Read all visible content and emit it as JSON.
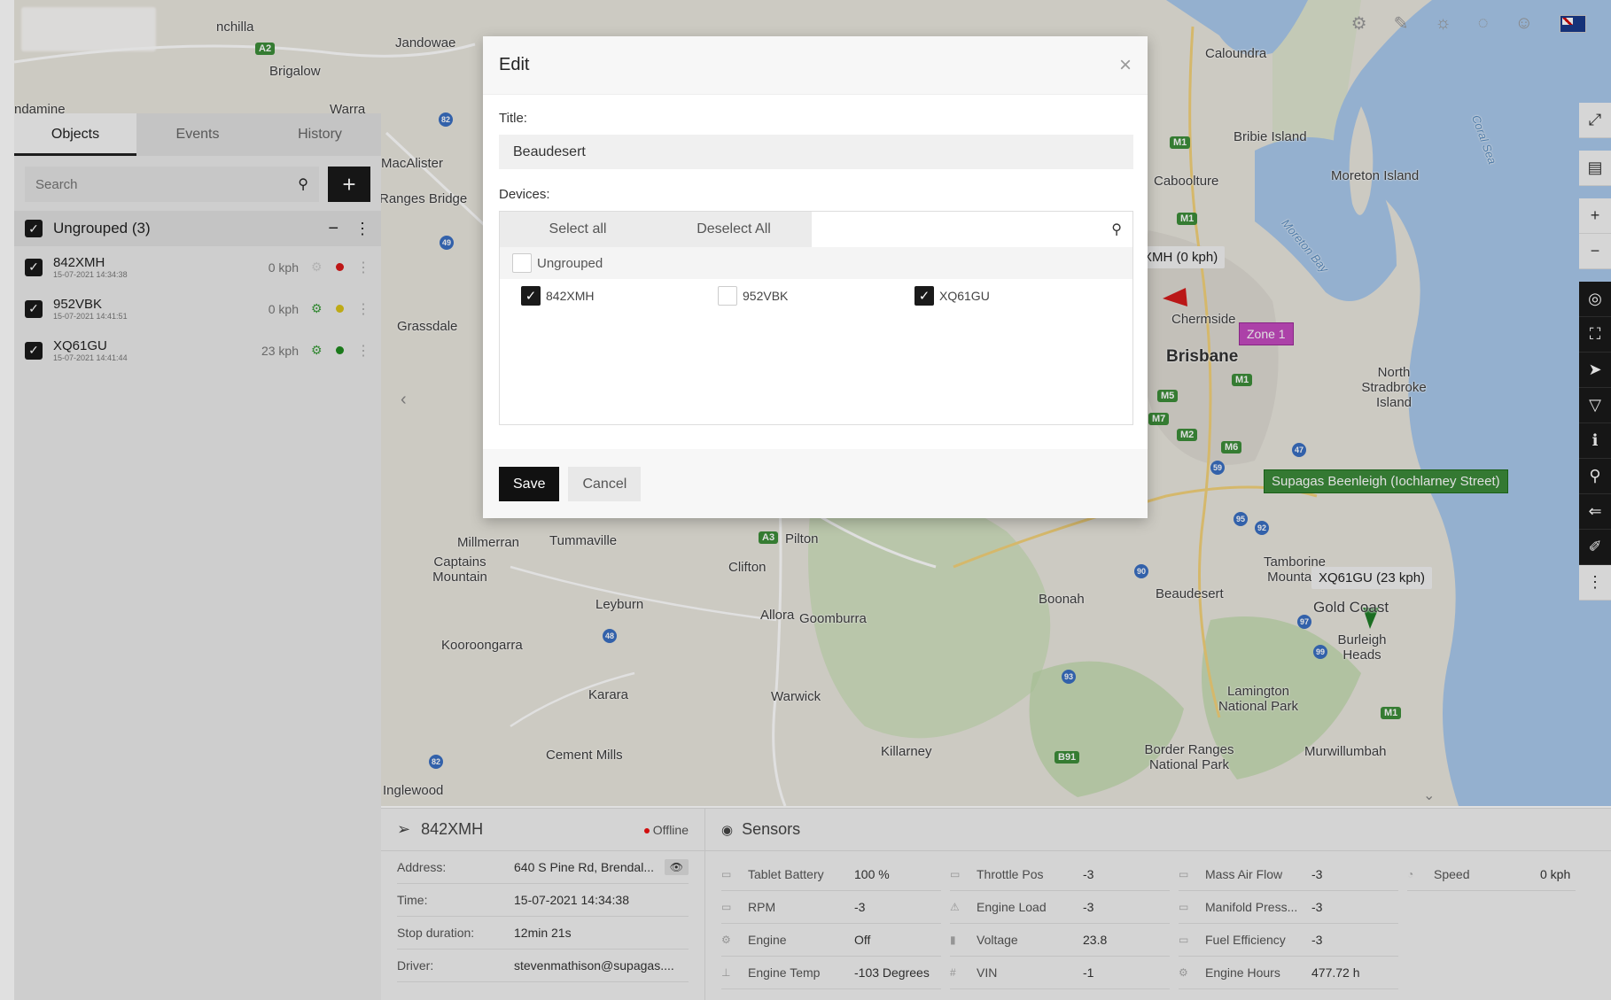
{
  "tabs": [
    "Objects",
    "Events",
    "History"
  ],
  "search": {
    "placeholder": "Search"
  },
  "group": {
    "label": "Ungrouped (3)"
  },
  "objects": [
    {
      "name": "842XMH",
      "time": "15-07-2021 14:34:38",
      "speed": "0 kph",
      "status_color": "#d91a1a",
      "engine_color": "#cccccc"
    },
    {
      "name": "952VBK",
      "time": "15-07-2021 14:41:51",
      "speed": "0 kph",
      "status_color": "#d9c21a",
      "engine_color": "#3a9b3a"
    },
    {
      "name": "XQ61GU",
      "time": "15-07-2021 14:41:44",
      "speed": "23 kph",
      "status_color": "#1f8a1f",
      "engine_color": "#3a9b3a"
    }
  ],
  "map": {
    "labels": [
      "Jandowae",
      "Brigalow",
      "Caloundra",
      "Bribie Island",
      "Moreton Island",
      "Moreton Bay",
      "Coral Sea",
      "Caboolture",
      "Chermside",
      "Brisbane",
      "North Stradbroke Island",
      "MacAlister",
      "Ranges Bridge",
      "Grassdale",
      "Millmerran",
      "Tummaville",
      "Pilton",
      "Clifton",
      "Captains Mountain",
      "Leyburn",
      "Allora",
      "Goomburra",
      "Boonah",
      "Beaudesert",
      "Tamborine Mountain",
      "Gold Coast",
      "Burleigh Heads",
      "Kooroongarra",
      "Karara",
      "Warwick",
      "Lamington National Park",
      "Killarney",
      "Cement Mills",
      "Border Ranges National Park",
      "Murwillumbah",
      "Inglewood",
      "nchilla",
      "ndamine",
      "Warra"
    ],
    "tags": {
      "truck1": "XMH (0 kph)",
      "zone": "Zone 1",
      "poi": "Supagas Beenleigh (Iochlarney Street)",
      "truck2": "XQ61GU (23 kph)"
    }
  },
  "modal": {
    "title": "Edit",
    "title_label": "Title:",
    "title_value": "Beaudesert",
    "devices_label": "Devices:",
    "select_all": "Select all",
    "deselect_all": "Deselect All",
    "group_name": "Ungrouped",
    "devices": [
      {
        "name": "842XMH",
        "checked": true
      },
      {
        "name": "952VBK",
        "checked": false
      },
      {
        "name": "XQ61GU",
        "checked": true
      }
    ],
    "save": "Save",
    "cancel": "Cancel"
  },
  "details": {
    "device": "842XMH",
    "status": "Offline",
    "rows": [
      {
        "key": "Address:",
        "value": "640 S Pine Rd, Brendal..."
      },
      {
        "key": "Time:",
        "value": "15-07-2021 14:34:38"
      },
      {
        "key": "Stop duration:",
        "value": "12min 21s"
      },
      {
        "key": "Driver:",
        "value": "stevenmathison@supagas...."
      }
    ]
  },
  "sensors": {
    "title": "Sensors",
    "items": [
      {
        "name": "Tablet Battery",
        "value": "100 %"
      },
      {
        "name": "Throttle Pos",
        "value": "-3"
      },
      {
        "name": "Mass Air Flow",
        "value": "-3"
      },
      {
        "name": "Speed",
        "value": "0 kph"
      },
      {
        "name": "RPM",
        "value": "-3"
      },
      {
        "name": "Engine Load",
        "value": "-3"
      },
      {
        "name": "Manifold Press...",
        "value": "-3"
      },
      {
        "name": "",
        "value": ""
      },
      {
        "name": "Engine",
        "value": "Off"
      },
      {
        "name": "Voltage",
        "value": "23.8"
      },
      {
        "name": "Fuel Efficiency",
        "value": "-3"
      },
      {
        "name": "",
        "value": ""
      },
      {
        "name": "Engine Temp",
        "value": "-103 Degrees"
      },
      {
        "name": "VIN",
        "value": "-1"
      },
      {
        "name": "Engine Hours",
        "value": "477.72 h"
      },
      {
        "name": "",
        "value": ""
      }
    ]
  }
}
